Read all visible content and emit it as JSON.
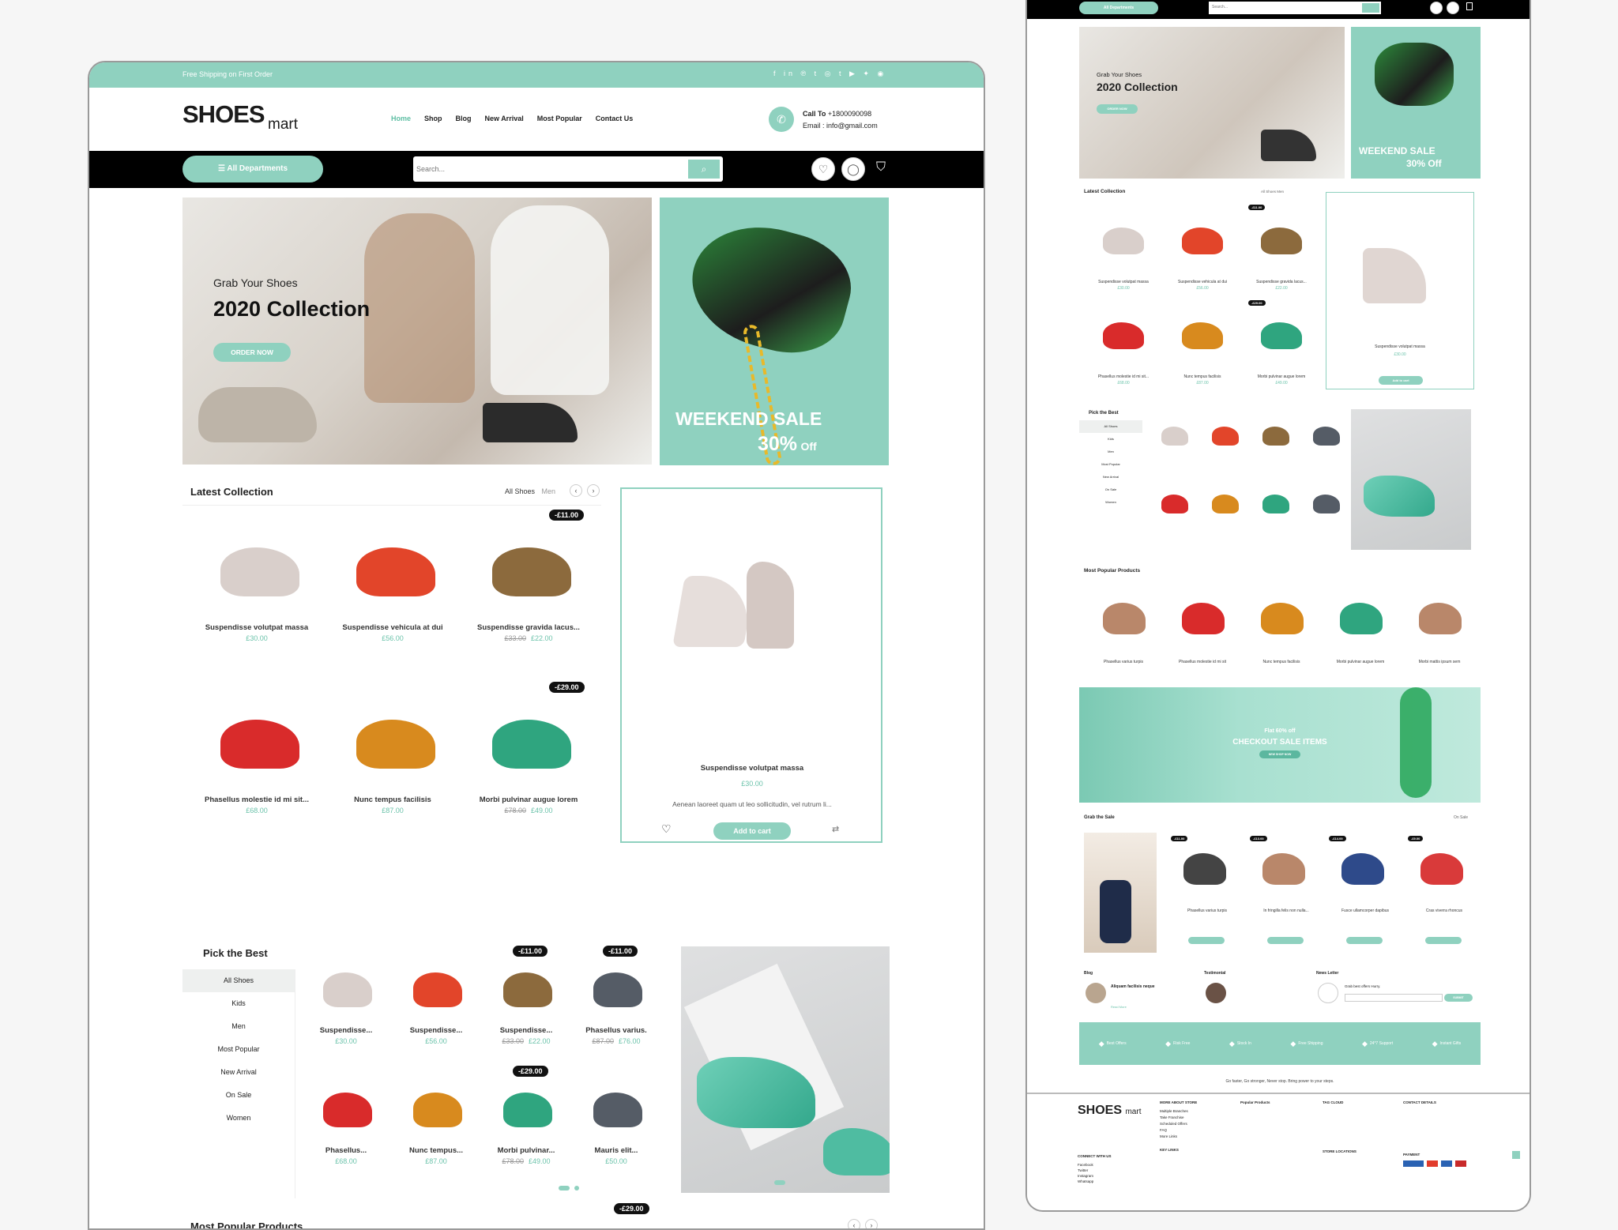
{
  "colors": {
    "accent": "#8fd1bf",
    "dark": "#000000",
    "badge": "#111111"
  },
  "topbar": {
    "text": "Free Shipping on First Order",
    "social": "f in ℗ t ◎ t ▶ ✦ ◉"
  },
  "logo": {
    "main": "SHOES",
    "sub": "mart"
  },
  "nav": [
    "Home",
    "Shop",
    "Blog",
    "New Arrival",
    "Most Popular",
    "Contact Us"
  ],
  "contact": {
    "call_label": "Call To",
    "phone": "+1800090098",
    "email_label": "Email :",
    "email": "info@gmail.com"
  },
  "catbar": {
    "departments": "All Departments",
    "search_placeholder": "Search..."
  },
  "hero": {
    "kicker": "Grab Your Shoes",
    "title": "2020 Collection",
    "button": "ORDER NOW",
    "sale_line1": "WEEKEND SALE",
    "sale_pct": "30%",
    "sale_off": "Off"
  },
  "latest": {
    "title": "Latest Collection",
    "tab_all": "All Shoes",
    "tab_men": "Men",
    "products": [
      {
        "name": "Suspendisse volutpat massa",
        "price": "£30.00",
        "old": "",
        "badge": ""
      },
      {
        "name": "Suspendisse vehicula at dui",
        "price": "£56.00",
        "old": "",
        "badge": ""
      },
      {
        "name": "Suspendisse gravida lacus...",
        "price": "£22.00",
        "old": "£33.00",
        "badge": "-£11.00"
      },
      {
        "name": "Phasellus molestie id mi sit...",
        "price": "£68.00",
        "old": "",
        "badge": ""
      },
      {
        "name": "Nunc tempus facilisis",
        "price": "£87.00",
        "old": "",
        "badge": ""
      },
      {
        "name": "Morbi pulvinar augue lorem",
        "price": "£49.00",
        "old": "£78.00",
        "badge": "-£29.00"
      }
    ],
    "feature": {
      "name": "Suspendisse volutpat massa",
      "price": "£30.00",
      "desc": "Aenean laoreet quam ut leo sollicitudin, vel rutrum li...",
      "button": "Add to cart"
    }
  },
  "pick": {
    "title": "Pick the Best",
    "cats": [
      "All Shoes",
      "Kids",
      "Men",
      "Most Popular",
      "New Arrival",
      "On Sale",
      "Women"
    ],
    "products": [
      {
        "name": "Suspendisse...",
        "price": "£30.00",
        "old": "",
        "badge": ""
      },
      {
        "name": "Suspendisse...",
        "price": "£56.00",
        "old": "",
        "badge": ""
      },
      {
        "name": "Suspendisse...",
        "price": "£22.00",
        "old": "£33.00",
        "badge": "-£11.00"
      },
      {
        "name": "Phasellus varius.",
        "price": "£76.00",
        "old": "£87.00",
        "badge": "-£11.00"
      },
      {
        "name": "Phasellus...",
        "price": "£68.00",
        "old": "",
        "badge": ""
      },
      {
        "name": "Nunc tempus...",
        "price": "£87.00",
        "old": "",
        "badge": ""
      },
      {
        "name": "Morbi pulvinar...",
        "price": "£49.00",
        "old": "£78.00",
        "badge": "-£29.00"
      },
      {
        "name": "Mauris elit...",
        "price": "£50.00",
        "old": "",
        "badge": ""
      }
    ]
  },
  "popular": {
    "title": "Most Popular Products",
    "badge": "-£29.00"
  },
  "mobile": {
    "dept": "All Departments",
    "search": "Search...",
    "hero_kicker": "Grab Your Shoes",
    "hero_title": "2020 Collection",
    "hero_btn": "ORDER NOW",
    "sale1": "WEEKEND SALE",
    "sale2": "30% Off",
    "latest": "Latest Collection",
    "latest_tabs": "All Shoes  Men",
    "latest_items": [
      "Suspendisse volutpat massa",
      "Suspendisse vehicula at dui",
      "Suspendisse gravida lacus...",
      "Phasellus molestie id mi sit...",
      "Nunc tempus facilisis",
      "Morbi pulvinar augue lorem"
    ],
    "latest_prices": [
      "£30.00",
      "£56.00",
      "£22.00",
      "£68.00",
      "£87.00",
      "£49.00"
    ],
    "badge1": "-£11.00",
    "badge2": "-£29.00",
    "feat_name": "Suspendisse volutpat massa",
    "feat_price": "£30.00",
    "feat_btn": "Add to cart",
    "pick": "Pick the Best",
    "pick_cats": [
      "All Shoes",
      "Kids",
      "Men",
      "Most Popular",
      "New Arrival",
      "On Sale",
      "Women"
    ],
    "popular": "Most Popular Products",
    "popular_items": [
      "Phasellus varius turpis",
      "Phasellus molestie id mi sit",
      "Nunc tempus facilisis",
      "Morbi pulvinar augue lorem",
      "Morbi mattis ipsum sem"
    ],
    "promo_small": "Flat 60% off",
    "promo_big": "CHECKOUT SALE ITEMS",
    "promo_btn": "NEW SHOP NOW",
    "grab": "Grab the Sale",
    "grab_link": "On Sale",
    "grab_badges": [
      "-£11.00",
      "-£13.00",
      "-£14.00",
      "-£9.00"
    ],
    "grab_items": [
      "Phasellus varius turpis",
      "In fringilla felis non nulla...",
      "Fusce ullamcorper dapibus",
      "Cras viverra rhoncus"
    ],
    "blog": "Blog",
    "blog_title": "Aliquam facilisis neque",
    "testimonial": "Testimonial",
    "newsletter": "News Letter",
    "newsletter_text": "Grab best offers Hurry.",
    "subscribe": "SUBMIT",
    "read_more": "Read More",
    "features": [
      "Best Offers",
      "Risk Free",
      "Stock In",
      "Free Shipping",
      "24*7 Support",
      "Instant Gifts"
    ],
    "tagline": "Go faster, Go stronger, Never stop. Bring power to your steps.",
    "footer_cols": [
      "MORE ABOUT STORE",
      "Popular Products",
      "TAG CLOUD",
      "CONTACT DETAILS"
    ],
    "footer_links": [
      "Multiple Branches",
      "Take Franchise",
      "Scheduled Offers",
      "FAQ",
      "More Links"
    ],
    "key_links": "KEY LINKS",
    "connect": "CONNECT WITH US",
    "store_loc": "STORE LOCATIONS",
    "payment": "PAYMENT",
    "social": [
      "Facebook",
      "Twitter",
      "Instagram",
      "Whatsapp"
    ]
  }
}
